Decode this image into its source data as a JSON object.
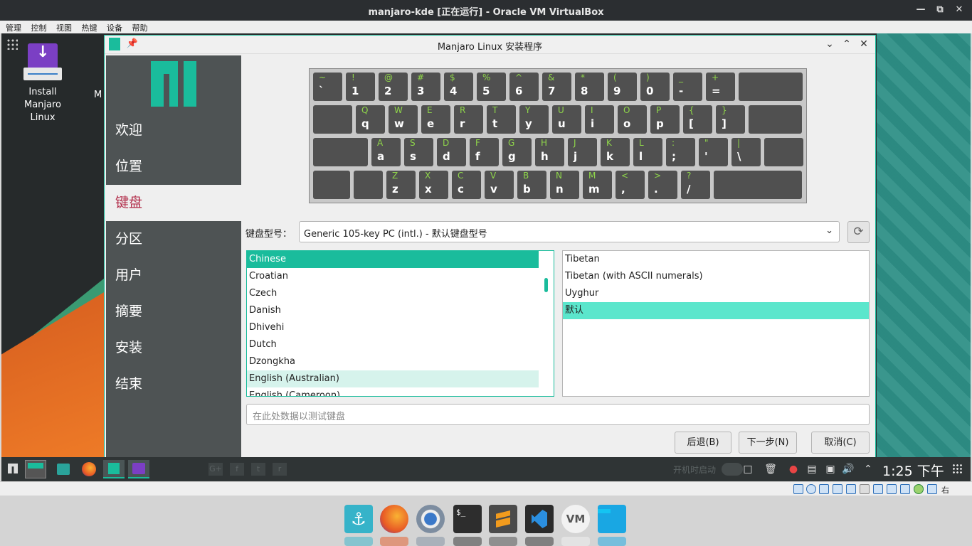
{
  "host": {
    "window_title": "manjaro-kde [正在运行] - Oracle VM VirtualBox",
    "menu": [
      "管理",
      "控制",
      "视图",
      "热键",
      "设备",
      "帮助"
    ],
    "host_key": "右 Ctrl"
  },
  "desktop": {
    "icons": [
      {
        "label": "Install Manjaro Linux"
      }
    ],
    "partial_icon_label": "M"
  },
  "installer": {
    "title": "Manjaro Linux 安装程序",
    "steps": [
      {
        "label": "欢迎",
        "active": false
      },
      {
        "label": "位置",
        "active": false
      },
      {
        "label": "键盘",
        "active": true
      },
      {
        "label": "分区",
        "active": false
      },
      {
        "label": "用户",
        "active": false
      },
      {
        "label": "摘要",
        "active": false
      },
      {
        "label": "安装",
        "active": false
      },
      {
        "label": "结束",
        "active": false
      }
    ],
    "keyboard_rows": [
      [
        [
          "~",
          "`"
        ],
        [
          "!",
          "1"
        ],
        [
          "@",
          "2"
        ],
        [
          "#",
          "3"
        ],
        [
          "$",
          "4"
        ],
        [
          "%",
          "5"
        ],
        [
          "^",
          "6"
        ],
        [
          "&",
          "7"
        ],
        [
          "*",
          "8"
        ],
        [
          "(",
          "9"
        ],
        [
          ")",
          "0"
        ],
        [
          "_",
          "-"
        ],
        [
          "+",
          "="
        ],
        [
          "",
          ""
        ]
      ],
      [
        [
          "",
          ""
        ],
        [
          "Q",
          "q"
        ],
        [
          "W",
          "w"
        ],
        [
          "E",
          "e"
        ],
        [
          "R",
          "r"
        ],
        [
          "T",
          "t"
        ],
        [
          "Y",
          "y"
        ],
        [
          "U",
          "u"
        ],
        [
          "I",
          "i"
        ],
        [
          "O",
          "o"
        ],
        [
          "P",
          "p"
        ],
        [
          "{",
          "["
        ],
        [
          "}",
          "]"
        ],
        [
          "",
          ""
        ]
      ],
      [
        [
          "",
          ""
        ],
        [
          "A",
          "a"
        ],
        [
          "S",
          "s"
        ],
        [
          "D",
          "d"
        ],
        [
          "F",
          "f"
        ],
        [
          "G",
          "g"
        ],
        [
          "H",
          "h"
        ],
        [
          "J",
          "j"
        ],
        [
          "K",
          "k"
        ],
        [
          "L",
          "l"
        ],
        [
          ":",
          ";"
        ],
        [
          "\"",
          "'"
        ],
        [
          "|",
          "\\"
        ],
        [
          "",
          ""
        ]
      ],
      [
        [
          "",
          ""
        ],
        [
          "",
          ""
        ],
        [
          "Z",
          "z"
        ],
        [
          "X",
          "x"
        ],
        [
          "C",
          "c"
        ],
        [
          "V",
          "v"
        ],
        [
          "B",
          "b"
        ],
        [
          "N",
          "n"
        ],
        [
          "M",
          "m"
        ],
        [
          "<",
          ","
        ],
        [
          ">",
          "."
        ],
        [
          "?",
          "/"
        ],
        [
          "",
          ""
        ]
      ]
    ],
    "model_label": "键盘型号：",
    "model_value": "Generic 105-key PC (intl.)  -  默认键盘型号",
    "layouts": [
      "Chinese",
      "Croatian",
      "Czech",
      "Danish",
      "Dhivehi",
      "Dutch",
      "Dzongkha",
      "English (Australian)",
      "English (Cameroon)"
    ],
    "layout_selected": "Chinese",
    "variants": [
      "Tibetan",
      "Tibetan (with ASCII numerals)",
      "Uyghur",
      "默认"
    ],
    "variant_selected": "默认",
    "test_placeholder": "在此处数据以测试键盘",
    "buttons": {
      "back": "后退(B)",
      "next": "下一步(N)",
      "cancel": "取消(C)"
    }
  },
  "guest_panel": {
    "autostart_text": "开机时启动",
    "clock": "1:25 下午"
  },
  "colors": {
    "accent": "#1abc9c",
    "sidebar": "#4e5354",
    "active_step_text": "#b22d4a",
    "key_bg": "#505050",
    "key_shift_label": "#8fd64a"
  }
}
